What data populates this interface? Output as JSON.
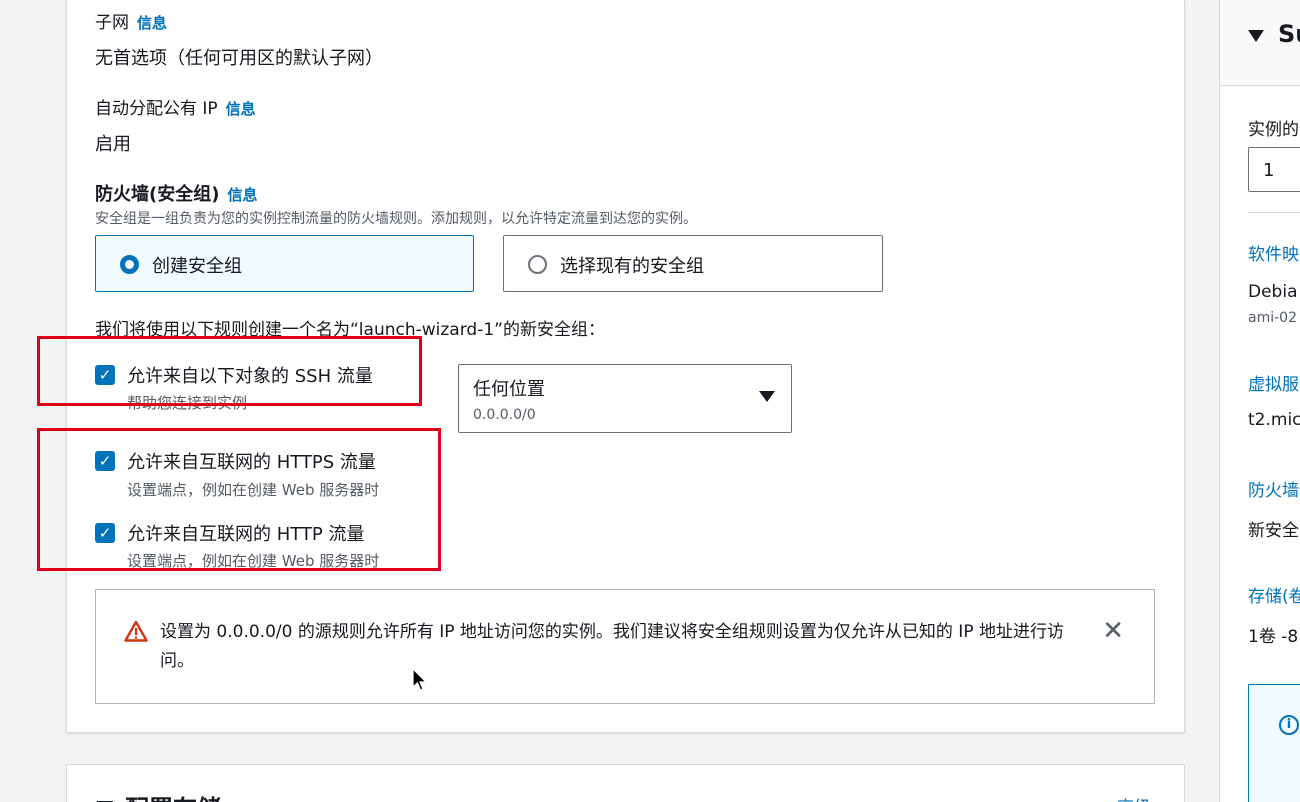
{
  "network": {
    "subnet_label": "子网",
    "subnet_info": "信息",
    "subnet_value": "无首选项（任何可用区的默认子网）",
    "public_ip_label": "自动分配公有 IP",
    "public_ip_info": "信息",
    "public_ip_value": "启用"
  },
  "firewall": {
    "title": "防火墙(安全组)",
    "info": "信息",
    "description": "安全组是一组负责为您的实例控制流量的防火墙规则。添加规则，以允许特定流量到达您的实例。",
    "option_create": "创建安全组",
    "option_existing": "选择现有的安全组",
    "selected": "create",
    "rule_intro": "我们将使用以下规则创建一个名为“launch-wizard-1”的新安全组：",
    "rules": [
      {
        "label": "允许来自以下对象的 SSH 流量",
        "desc": "帮助您连接到实例",
        "checked": true
      },
      {
        "label": "允许来自互联网的 HTTPS 流量",
        "desc": "设置端点，例如在创建 Web 服务器时",
        "checked": true
      },
      {
        "label": "允许来自互联网的 HTTP 流量",
        "desc": "设置端点，例如在创建 Web 服务器时",
        "checked": true
      }
    ],
    "ssh_source": {
      "value": "任何位置",
      "sub": "0.0.0.0/0"
    },
    "warning": "设置为 0.0.0.0/0 的源规则允许所有 IP 地址访问您的实例。我们建议将安全组规则设置为仅允许从已知的 IP 地址进行访问。"
  },
  "storage": {
    "title": "配置存储",
    "advanced_link": "高级"
  },
  "summary": {
    "title": "Su",
    "instances_label": "实例的",
    "instances_value": "1",
    "software_label": "软件映",
    "software_value": "Debia",
    "ami_value": "ami-02",
    "vm_label": "虚拟服",
    "vm_value": "t2.mic",
    "firewall_label": "防火墙",
    "firewall_value": "新安全",
    "storage_label": "存储(卷",
    "storage_value": "1卷 -8"
  },
  "colors": {
    "accent": "#0073bb",
    "highlight": "#e0001a",
    "warning": "#d13212"
  }
}
